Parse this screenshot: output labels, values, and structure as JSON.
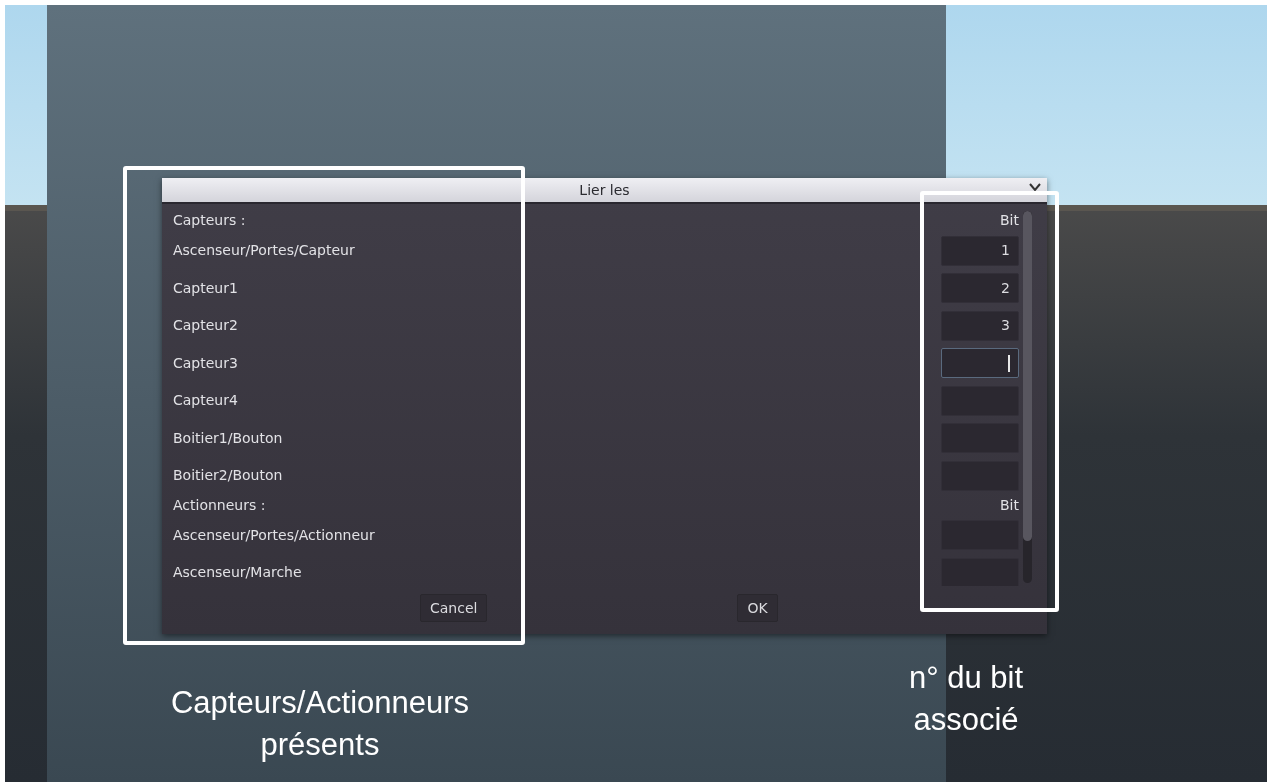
{
  "dialog": {
    "title": "Lier les",
    "sections": [
      {
        "heading": "Capteurs :",
        "column_heading": "Bit",
        "items": [
          {
            "label": "Ascenseur/Portes/Capteur",
            "bit": "1",
            "focused": false
          },
          {
            "label": "Capteur1",
            "bit": "2",
            "focused": false
          },
          {
            "label": "Capteur2",
            "bit": "3",
            "focused": false
          },
          {
            "label": "Capteur3",
            "focused": true
          },
          {
            "label": "Capteur4",
            "focused": false
          },
          {
            "label": "Boitier1/Bouton",
            "focused": false
          },
          {
            "label": "Boitier2/Bouton",
            "focused": false
          }
        ]
      },
      {
        "heading": "Actionneurs :",
        "column_heading": "Bit",
        "items": [
          {
            "label": "Ascenseur/Portes/Actionneur",
            "focused": false
          },
          {
            "label": "Ascenseur/Marche",
            "focused": false
          }
        ]
      }
    ],
    "buttons": [
      {
        "label": "Cancel"
      },
      {
        "label": "OK"
      }
    ]
  },
  "annotations": [
    {
      "text": "Capteurs/Actionneurs présents"
    },
    {
      "text": "n° du bit associé"
    }
  ]
}
